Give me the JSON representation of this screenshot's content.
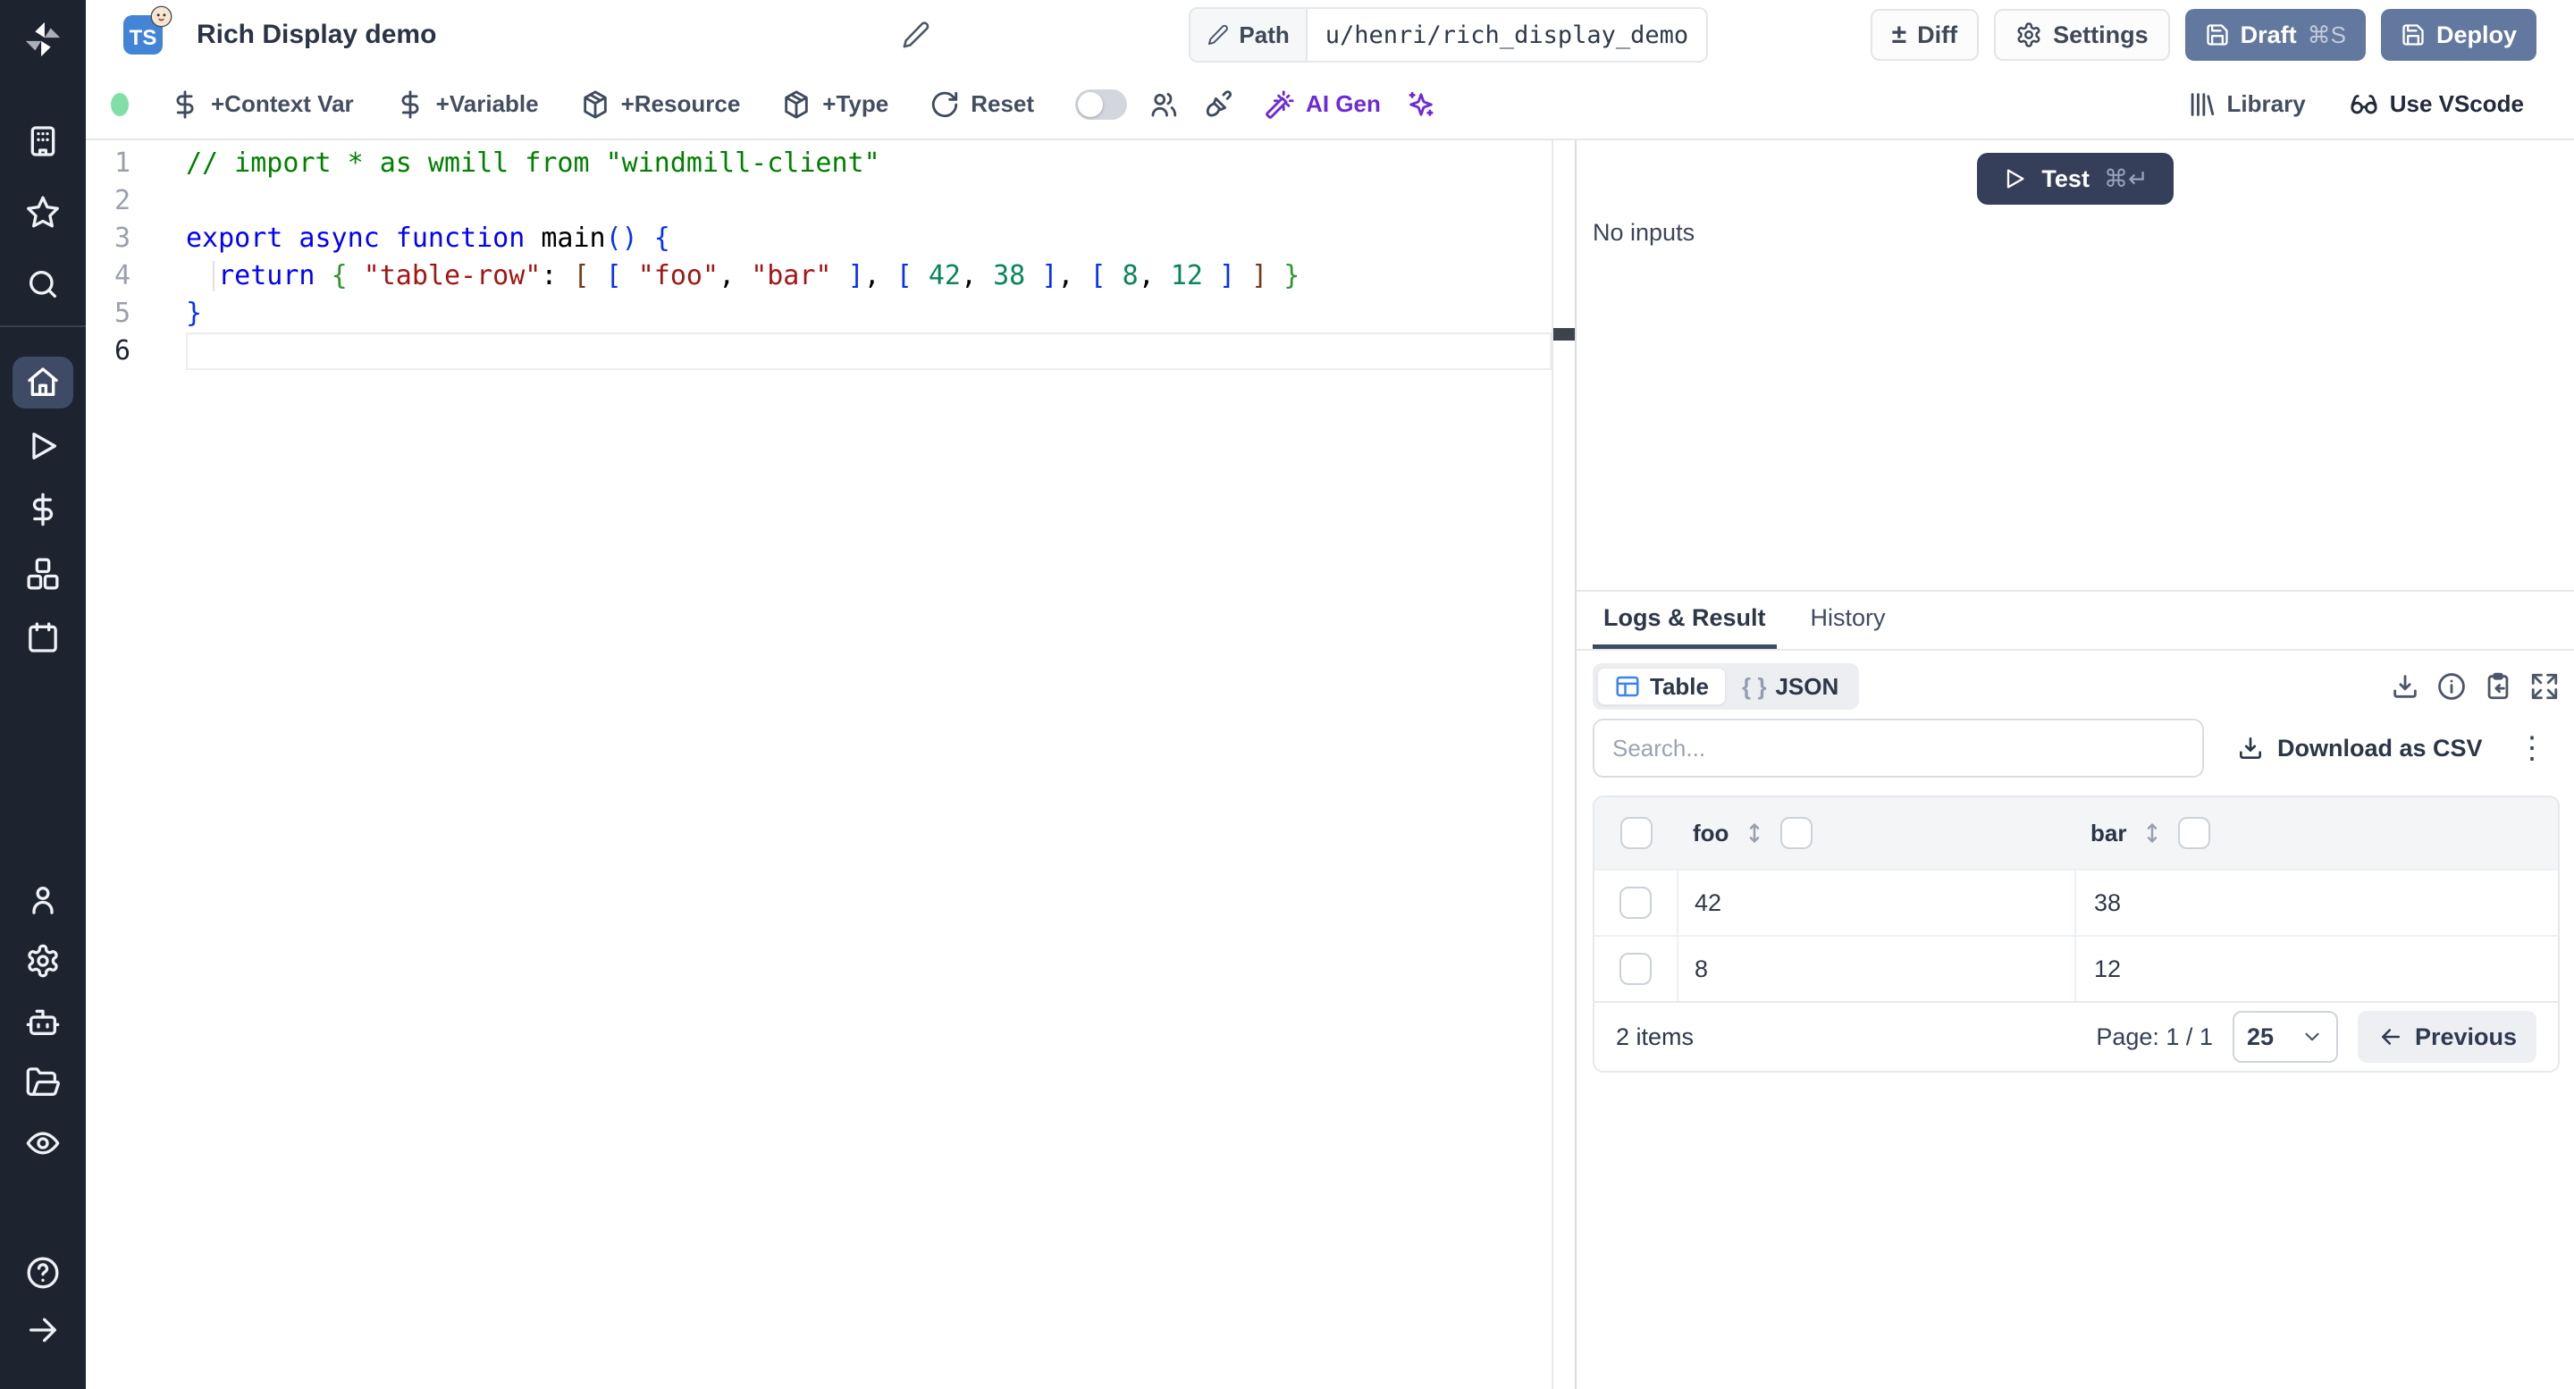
{
  "colors": {
    "sidebar_bg": "#1e2330",
    "sidebar_active_bg": "#3f4b66",
    "slate_button": "#62789e",
    "dark_button": "#353f59",
    "purple_accent": "#6d2ad6",
    "green_status_dot": "#81dfa5",
    "table_icon_blue": "#3b82f6",
    "tab_underline": "#3d4a61",
    "ts_badge_blue": "#4484d7"
  },
  "header": {
    "language_badge": "TS",
    "title": "Rich Display demo",
    "path_label": "Path",
    "path_value": "u/henri/rich_display_demo",
    "diff": "Diff",
    "settings": "Settings",
    "draft": "Draft",
    "draft_shortcut": "⌘S",
    "deploy": "Deploy"
  },
  "toolbar": {
    "add_context_var": "+Context Var",
    "add_variable": "+Variable",
    "add_resource": "+Resource",
    "add_type": "+Type",
    "reset": "Reset",
    "ai_gen": "AI Gen",
    "library": "Library",
    "use_vscode": "Use VScode"
  },
  "sidebar": {
    "icons": [
      "windmill-logo",
      "building",
      "star",
      "search",
      "home",
      "play",
      "dollar",
      "boxes",
      "calendar",
      "user",
      "settings-gear",
      "robot",
      "folder-open",
      "eye",
      "help-circle",
      "arrow-right"
    ],
    "active_icon": "home"
  },
  "editor": {
    "lines": [
      {
        "num": "1",
        "tokens": [
          [
            "comment",
            "// import * as wmill from \"windmill-client\""
          ]
        ]
      },
      {
        "num": "2",
        "tokens": []
      },
      {
        "num": "3",
        "tokens": [
          [
            "kw",
            "export async function "
          ],
          [
            "fn",
            "main"
          ],
          [
            "b1",
            "()"
          ],
          [
            "plain",
            " "
          ],
          [
            "b1",
            "{"
          ]
        ]
      },
      {
        "num": "4",
        "guide": true,
        "tokens": [
          [
            "plain",
            "  "
          ],
          [
            "kw",
            "return"
          ],
          [
            "plain",
            " "
          ],
          [
            "b2",
            "{"
          ],
          [
            "plain",
            " "
          ],
          [
            "str",
            "\"table-row\""
          ],
          [
            "plain",
            ": "
          ],
          [
            "b3",
            "["
          ],
          [
            "plain",
            " "
          ],
          [
            "b1",
            "["
          ],
          [
            "plain",
            " "
          ],
          [
            "str",
            "\"foo\""
          ],
          [
            "plain",
            ", "
          ],
          [
            "str",
            "\"bar\""
          ],
          [
            "plain",
            " "
          ],
          [
            "b1",
            "]"
          ],
          [
            "plain",
            ", "
          ],
          [
            "b1",
            "["
          ],
          [
            "plain",
            " "
          ],
          [
            "num",
            "42"
          ],
          [
            "plain",
            ", "
          ],
          [
            "num",
            "38"
          ],
          [
            "plain",
            " "
          ],
          [
            "b1",
            "]"
          ],
          [
            "plain",
            ", "
          ],
          [
            "b1",
            "["
          ],
          [
            "plain",
            " "
          ],
          [
            "num",
            "8"
          ],
          [
            "plain",
            ", "
          ],
          [
            "num",
            "12"
          ],
          [
            "plain",
            " "
          ],
          [
            "b1",
            "]"
          ],
          [
            "plain",
            " "
          ],
          [
            "b3",
            "]"
          ],
          [
            "plain",
            " "
          ],
          [
            "b2",
            "}"
          ]
        ]
      },
      {
        "num": "5",
        "tokens": [
          [
            "b1",
            "}"
          ]
        ]
      },
      {
        "num": "6",
        "active": true,
        "tokens": []
      }
    ]
  },
  "run": {
    "test": "Test",
    "test_shortcut": "⌘↵",
    "no_inputs": "No inputs"
  },
  "result_panel": {
    "tabs": [
      "Logs & Result",
      "History"
    ],
    "active_tab": "Logs & Result",
    "view_table": "Table",
    "view_json": "JSON",
    "json_braces": "{ }",
    "search_placeholder": "Search...",
    "download_csv": "Download as CSV",
    "kebab": "⋮"
  },
  "result_table": {
    "columns": [
      "foo",
      "bar"
    ],
    "rows": [
      [
        "42",
        "38"
      ],
      [
        "8",
        "12"
      ]
    ],
    "items_text": "2 items",
    "page_label": "Page: 1 / 1",
    "page_size": "25",
    "previous": "Previous"
  }
}
